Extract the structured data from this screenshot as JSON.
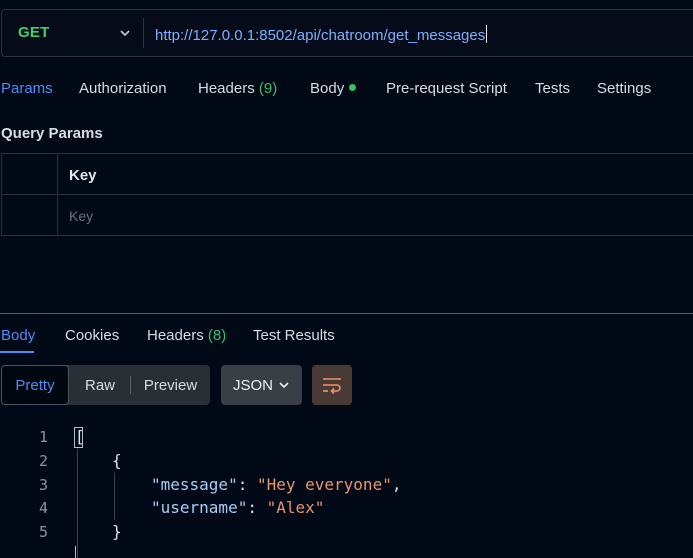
{
  "request": {
    "method": "GET",
    "url": "http://127.0.0.1:8502/api/chatroom/get_messages"
  },
  "request_tabs": {
    "params": "Params",
    "authorization": "Authorization",
    "headers": "Headers",
    "headers_count": "(9)",
    "body": "Body",
    "prerequest": "Pre-request Script",
    "tests": "Tests",
    "settings": "Settings"
  },
  "query_params": {
    "title": "Query Params",
    "column_key": "Key",
    "key_placeholder": "Key"
  },
  "response_tabs": {
    "body": "Body",
    "cookies": "Cookies",
    "headers": "Headers",
    "headers_count": "(8)",
    "test_results": "Test Results"
  },
  "view": {
    "pretty": "Pretty",
    "raw": "Raw",
    "preview": "Preview",
    "format": "JSON"
  },
  "code": {
    "line_numbers": [
      "1",
      "2",
      "3",
      "4",
      "5"
    ],
    "open_array": "[",
    "open_obj": "{",
    "key_message": "\"message\"",
    "val_message": "\"Hey everyone\"",
    "key_username": "\"username\"",
    "val_username": "\"Alex\"",
    "close_obj": "}"
  },
  "colors": {
    "method": "#3ecf6e",
    "url": "#7eb0ff",
    "accent": "#4f8cf7",
    "count": "#35c06b",
    "json_key": "#a8cdf5",
    "json_string": "#e8956b"
  }
}
